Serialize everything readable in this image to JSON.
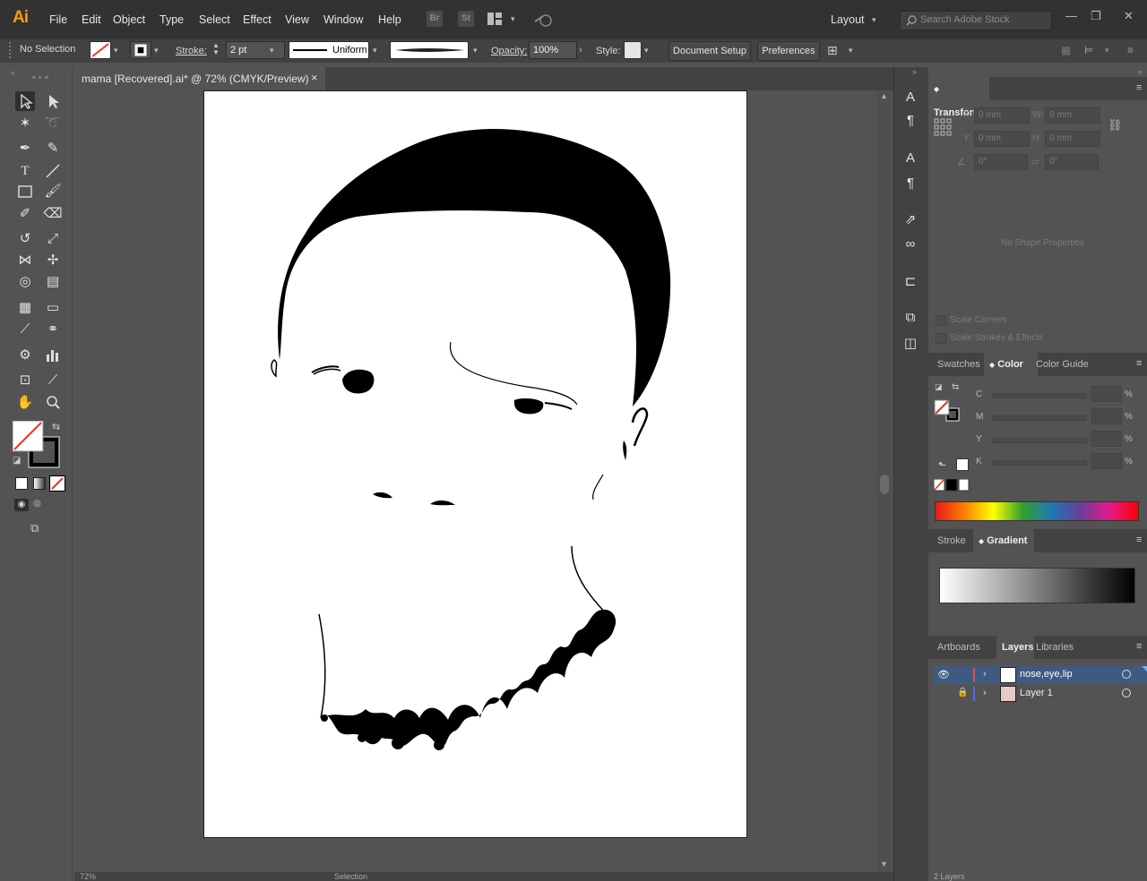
{
  "app": {
    "logo": "Ai"
  },
  "menu": [
    "File",
    "Edit",
    "Object",
    "Type",
    "Select",
    "Effect",
    "View",
    "Window",
    "Help"
  ],
  "menubar_buttons": {
    "br": "Br",
    "st": "St"
  },
  "workspace": "Layout",
  "search": {
    "placeholder": "Search Adobe Stock"
  },
  "controlbar": {
    "selection": "No Selection",
    "stroke_label": "Stroke:",
    "stroke_value": "2 pt",
    "profile": "Uniform",
    "opacity_label": "Opacity:",
    "opacity_value": "100%",
    "style_label": "Style:",
    "doc_setup": "Document Setup",
    "preferences": "Preferences"
  },
  "document": {
    "tab_title": "mama [Recovered].ai* @ 72% (CMYK/Preview)",
    "close": "×"
  },
  "status": {
    "zoom": "72%",
    "mode": "Selection"
  },
  "transform": {
    "tab": "Transform",
    "x_label": "X:",
    "x": "0 mm",
    "w_label": "W:",
    "w": "0 mm",
    "y_label": "Y:",
    "y": "0 mm",
    "h_label": "H:",
    "h": "0 mm",
    "angle": "0°",
    "shear": "0°",
    "no_props": "No Shape Properties",
    "scale_corners": "Scale Corners",
    "scale_strokes": "Scale Strokes & Effects"
  },
  "color_panel": {
    "tabs": [
      "Swatches",
      "Color",
      "Color Guide"
    ],
    "channels": [
      "C",
      "M",
      "Y",
      "K"
    ],
    "pct": "%"
  },
  "gradient_panel": {
    "tabs": [
      "Stroke",
      "Gradient"
    ]
  },
  "layers_panel": {
    "tabs": [
      "Artboards",
      "Layers",
      "Libraries"
    ],
    "layers": [
      {
        "name": "nose,eye,lip",
        "color": "#e54b4b"
      },
      {
        "name": "Layer 1",
        "color": "#4b6ee5"
      }
    ],
    "count": "2 Layers"
  }
}
